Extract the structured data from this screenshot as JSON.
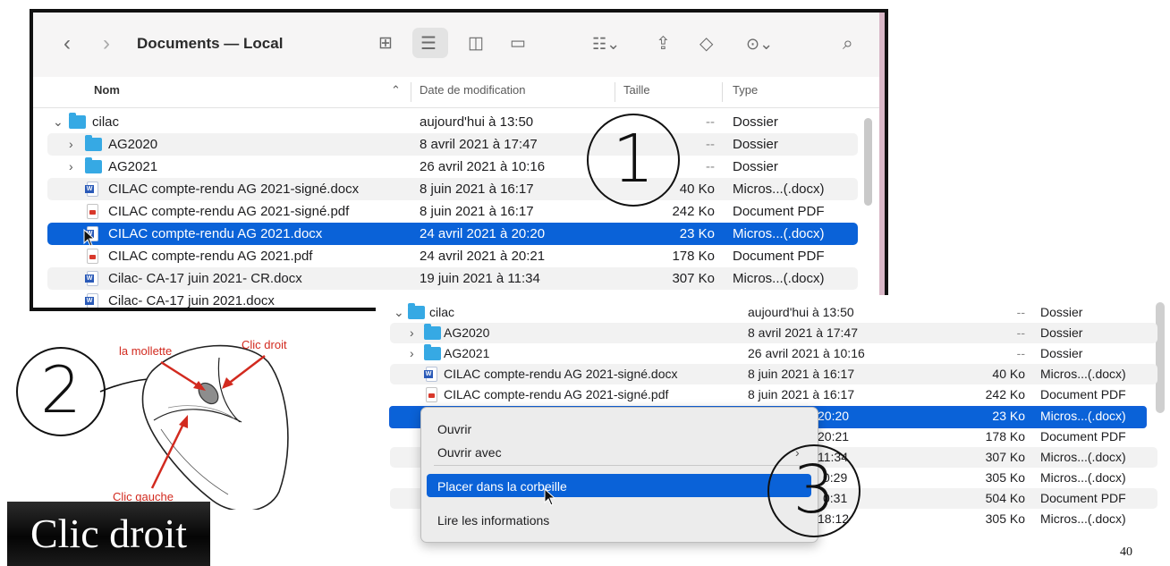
{
  "window1": {
    "title": "Documents — Local",
    "toolbar_icons": [
      "back-icon",
      "forward-icon",
      "icon-view-icon",
      "list-view-icon",
      "column-view-icon",
      "gallery-view-icon",
      "group-icon",
      "share-icon",
      "tag-icon",
      "more-icon",
      "search-icon"
    ],
    "columns": {
      "name": "Nom",
      "date": "Date de modification",
      "size": "Taille",
      "type": "Type"
    },
    "rows": [
      {
        "name": "cilac",
        "date": "aujourd'hui à 13:50",
        "size": "--",
        "type": "Dossier",
        "kind": "folder",
        "expanded": true
      },
      {
        "name": "AG2020",
        "date": "8 avril 2021 à 17:47",
        "size": "--",
        "type": "Dossier",
        "kind": "folder"
      },
      {
        "name": "AG2021",
        "date": "26 avril 2021 à 10:16",
        "size": "--",
        "type": "Dossier",
        "kind": "folder"
      },
      {
        "name": "CILAC compte-rendu AG 2021-signé.docx",
        "date": "8 juin 2021 à 16:17",
        "size": "40 Ko",
        "type": "Micros...(.docx)",
        "kind": "docx"
      },
      {
        "name": "CILAC compte-rendu AG 2021-signé.pdf",
        "date": "8 juin 2021 à 16:17",
        "size": "242 Ko",
        "type": "Document PDF",
        "kind": "pdf"
      },
      {
        "name": "CILAC compte-rendu AG 2021.docx",
        "date": "24 avril 2021 à 20:20",
        "size": "23 Ko",
        "type": "Micros...(.docx)",
        "kind": "docx",
        "selected": true
      },
      {
        "name": "CILAC compte-rendu AG 2021.pdf",
        "date": "24 avril 2021 à 20:21",
        "size": "178 Ko",
        "type": "Document PDF",
        "kind": "pdf"
      },
      {
        "name": "Cilac- CA-17 juin 2021- CR.docx",
        "date": "19 juin 2021 à 11:34",
        "size": "307 Ko",
        "type": "Micros...(.docx)",
        "kind": "docx"
      },
      {
        "name": "Cilac- CA-17 juin 2021.docx",
        "date": "",
        "size": "",
        "type": "",
        "kind": "docx"
      }
    ]
  },
  "window2": {
    "rows": [
      {
        "name": "cilac",
        "date": "aujourd'hui à 13:50",
        "size": "--",
        "type": "Dossier"
      },
      {
        "name": "AG2020",
        "date": "8 avril 2021 à 17:47",
        "size": "--",
        "type": "Dossier"
      },
      {
        "name": "AG2021",
        "date": "26 avril 2021 à 10:16",
        "size": "--",
        "type": "Dossier"
      },
      {
        "name": "CILAC compte-rendu AG 2021-signé.docx",
        "date": "8 juin 2021 à 16:17",
        "size": "40 Ko",
        "type": "Micros...(.docx)"
      },
      {
        "name": "CILAC compte-rendu AG 2021-signé.pdf",
        "date": "8 juin 2021 à 16:17",
        "size": "242 Ko",
        "type": "Document PDF"
      },
      {
        "name": "",
        "date": "20:20",
        "size": "23 Ko",
        "type": "Micros...(.docx)"
      },
      {
        "name": "",
        "date": "20:21",
        "size": "178 Ko",
        "type": "Document PDF"
      },
      {
        "name": "",
        "date": "11:34",
        "size": "307 Ko",
        "type": "Micros...(.docx)"
      },
      {
        "name": "",
        "date": "0:29",
        "size": "305 Ko",
        "type": "Micros...(.docx)"
      },
      {
        "name": "",
        "date": "0:31",
        "size": "504 Ko",
        "type": "Document PDF"
      },
      {
        "name": "",
        "date": "18:12",
        "size": "305 Ko",
        "type": "Micros...(.docx)"
      }
    ]
  },
  "context_menu": {
    "items": [
      "Ouvrir",
      "Ouvrir avec",
      "Placer dans la corbeille",
      "Lire les informations"
    ],
    "highlighted": "Placer dans la corbeille"
  },
  "annotations": {
    "step1": "1",
    "step2": "2",
    "step3": "3",
    "mouse_labels": {
      "wheel": "la mollette",
      "right": "Clic droit",
      "left": "Clic gauche"
    },
    "badge": "Clic droit",
    "page_number": "40"
  },
  "colors": {
    "selection": "#0a62d8",
    "folder": "#36a9e4",
    "annotation_red": "#d22a1f"
  }
}
